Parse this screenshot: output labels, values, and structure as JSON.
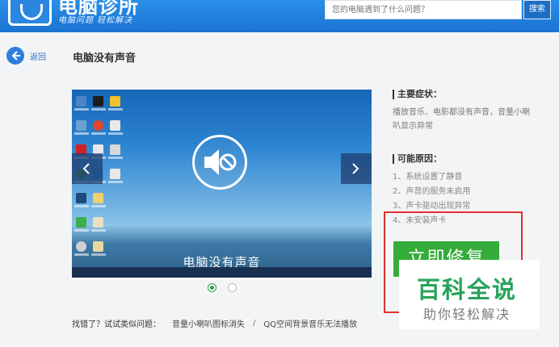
{
  "header": {
    "logo_title": "电脑诊所",
    "logo_sub": "电脑问题 轻松解决",
    "search_placeholder": "您的电脑遇到了什么问题？",
    "search_button": "搜索"
  },
  "nav": {
    "back_label": "返回"
  },
  "page": {
    "title": "电脑没有声音"
  },
  "preview": {
    "caption": "电脑没有声音",
    "slide_count": 2,
    "active_slide": 1
  },
  "info": {
    "symptom_title": "主要症状：",
    "symptom_text": "播放音乐、电影都没有声音，音量小喇叭显示异常",
    "cause_title": "可能原因：",
    "causes": [
      "1、系统设置了静音",
      "2、声音的服务未启用",
      "3、声卡驱动出现异常",
      "4、未安装声卡"
    ]
  },
  "fix_button": "立即修复",
  "watermark": {
    "title": "百科全说",
    "subtitle": "助你轻松解决"
  },
  "related": {
    "label": "找错了？试试类似问题：",
    "links": [
      "音量小喇叭图标消失",
      "QQ空间背景音乐无法播放"
    ],
    "separator": "/"
  },
  "colors": {
    "header": "#1b73d1",
    "fix": "#34ad3a",
    "highlight": "#e03030",
    "watermark": "#26a35a"
  }
}
